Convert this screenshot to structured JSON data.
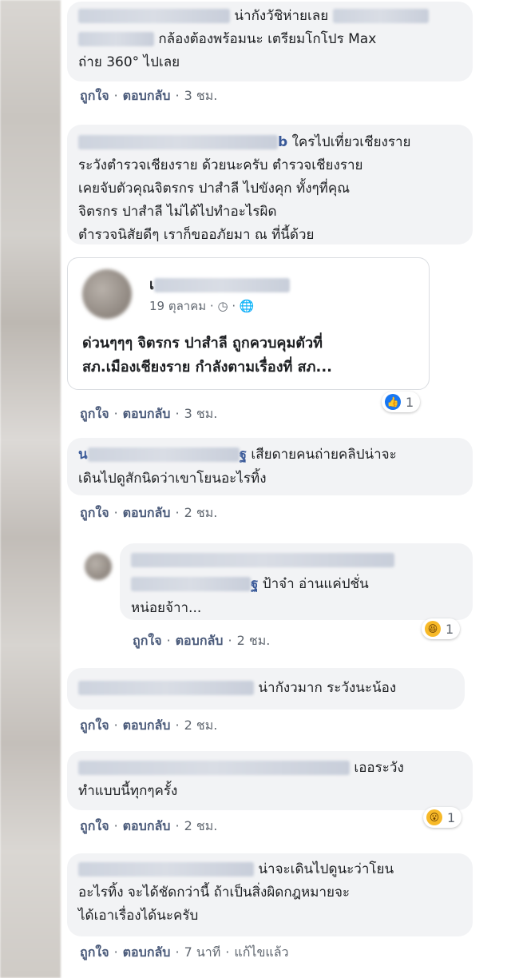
{
  "actions": {
    "like": "ถูกใจ",
    "reply": "ตอบกลับ",
    "edited": "แก้ไขแล้ว"
  },
  "comments": [
    {
      "line1": "น่ากังวัชิห่ายเลย",
      "line2": "กล้องต้องพร้อมนะ เตรียมโกโปร Max",
      "line3": "ถ่าย 360° ไปเลย",
      "time": "3 ชม."
    },
    {
      "name_tail": "b",
      "line1": "ใครไปเที่ยวเชียงราย",
      "line2": "ระวังตำรวจเชียงราย ด้วยนะครับ ตำรวจเชียงราย",
      "line3": "เคยจับตัวคุณจิตรกร ปาสำลี ไปขังคุก ทั้งๆที่คุณ",
      "line4": "จิตรกร ปาสำลี ไม่ได้ไปทำอะไรผิด",
      "line5": "ตำรวจนิสัยดีๆ เราก็ขออภัยมา ณ ที่นี้ด้วย",
      "time": "3 ชม.",
      "reaction_count": "1"
    },
    {
      "name_head": "น",
      "name_tail": "ฐ",
      "line1": "เสียดายคนถ่ายคลิปน่าจะ",
      "line2": "เดินไปดูสักนิดว่าเขาโยนอะไรทิ้ง",
      "time": "2 ชม."
    },
    {
      "name_tail": "ฐ",
      "line1": "ป้าจ๋า อ่านแค่ปชั่น",
      "line2": "หน่อยจ้าา...",
      "time": "2 ชม.",
      "reaction_count": "1"
    },
    {
      "line1": "น่ากังวมาก ระวังนะน้อง",
      "time": "2 ชม."
    },
    {
      "line1": "เออระวัง",
      "line2": "ทำแบบนี้ทุกๆครั้ง",
      "time": "2 ชม.",
      "reaction_count": "1"
    },
    {
      "line1": "น่าจะเดินไปดูนะว่าโยน",
      "line2": "อะไรทิ้ง จะได้ชัดกว่านี้ ถ้าเป็นสิ่งผิดกฎหมายจะ",
      "line3": "ได้เอาเรื่องได้นะครับ",
      "time": "7 นาที"
    }
  ],
  "shared_post": {
    "author_head": "เ",
    "date": "19 ตุลาคม",
    "text_line1": "ด่วนๆๆๆ จิตรกร ปาสำลี ถูกควบคุมตัวที่",
    "text_line2": "สภ.เมืองเชียงราย กำลังตามเรื่องที่ สภ..."
  }
}
